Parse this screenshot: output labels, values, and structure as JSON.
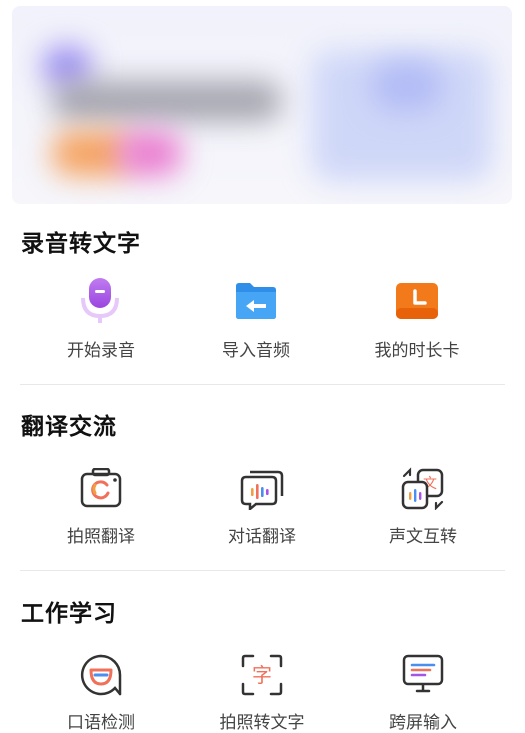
{
  "sections": [
    {
      "title": "录音转文字",
      "items": [
        {
          "label": "开始录音",
          "icon": "microphone-icon"
        },
        {
          "label": "导入音频",
          "icon": "folder-icon"
        },
        {
          "label": "我的时长卡",
          "icon": "clock-card-icon"
        }
      ]
    },
    {
      "title": "翻译交流",
      "items": [
        {
          "label": "拍照翻译",
          "icon": "camera-translate-icon"
        },
        {
          "label": "对话翻译",
          "icon": "dialog-translate-icon"
        },
        {
          "label": "声文互转",
          "icon": "voice-text-convert-icon"
        }
      ]
    },
    {
      "title": "工作学习",
      "items": [
        {
          "label": "口语检测",
          "icon": "speaking-test-icon"
        },
        {
          "label": "拍照转文字",
          "icon": "photo-to-text-icon"
        },
        {
          "label": "跨屏输入",
          "icon": "cross-screen-input-icon"
        }
      ]
    }
  ],
  "colors": {
    "mic": "#a653e8",
    "folder": "#2f8ee8",
    "clock": "#f27a1a",
    "line_icon": "#333333"
  }
}
